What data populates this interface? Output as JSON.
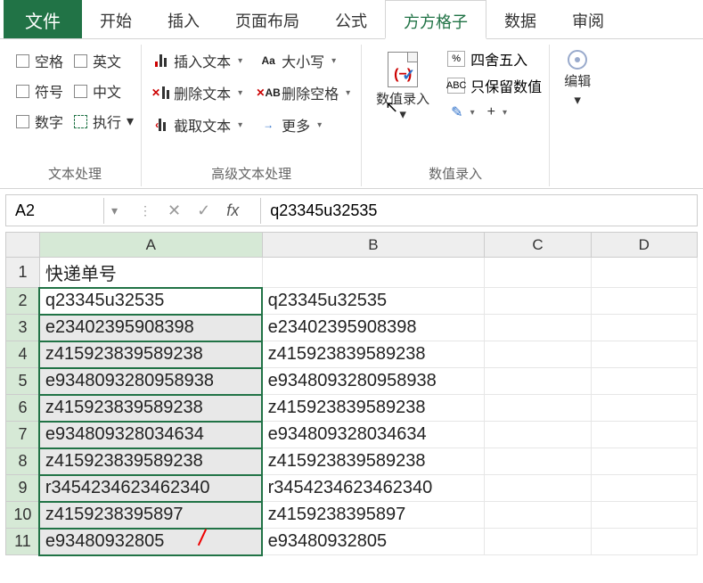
{
  "tabs": {
    "file": "文件",
    "start": "开始",
    "insert": "插入",
    "layout": "页面布局",
    "formula": "公式",
    "fangfang": "方方格子",
    "data": "数据",
    "review": "审阅"
  },
  "text_proc": {
    "space": "空格",
    "english": "英文",
    "symbol": "符号",
    "chinese": "中文",
    "number": "数字",
    "execute": "执行",
    "group_label": "文本处理"
  },
  "adv_text": {
    "insert_text": "插入文本",
    "delete_text": "删除文本",
    "extract_text": "截取文本",
    "case": "大小写",
    "del_space": "删除空格",
    "more": "更多",
    "aa_label": "Aa",
    "xab_label": "AB",
    "arrow": "→",
    "group_label": "高级文本处理"
  },
  "num_entry": {
    "btn_label": "数值录入",
    "round": "四舍五入",
    "keep_num": "只保留数值",
    "abc_label": "ABC",
    "pct_label": "%",
    "pencil": "✎",
    "plus": "+",
    "group_label": "数值录入"
  },
  "edit": {
    "label": "编辑"
  },
  "formula_bar": {
    "name_box": "A2",
    "x": "✕",
    "check": "✓",
    "fx": "fx",
    "value": "q23345u32535"
  },
  "sheet": {
    "cols": [
      "A",
      "B",
      "C",
      "D"
    ],
    "header_row": "1",
    "header": "快递单号",
    "rows": [
      {
        "n": "2",
        "a": "q23345u32535",
        "b": "q23345u32535"
      },
      {
        "n": "3",
        "a": "e23402395908398",
        "b": "e23402395908398"
      },
      {
        "n": "4",
        "a": "z415923839589238",
        "b": "z415923839589238"
      },
      {
        "n": "5",
        "a": "e9348093280958938",
        "b": "e9348093280958938"
      },
      {
        "n": "6",
        "a": "z415923839589238",
        "b": "z415923839589238"
      },
      {
        "n": "7",
        "a": "e934809328034634",
        "b": "e934809328034634"
      },
      {
        "n": "8",
        "a": "z415923839589238",
        "b": "z415923839589238"
      },
      {
        "n": "9",
        "a": "r3454234623462340",
        "b": "r3454234623462340"
      },
      {
        "n": "10",
        "a": "z4159238395897",
        "b": "z4159238395897"
      },
      {
        "n": "11",
        "a": "e93480932805",
        "b": "e93480932805"
      }
    ]
  }
}
